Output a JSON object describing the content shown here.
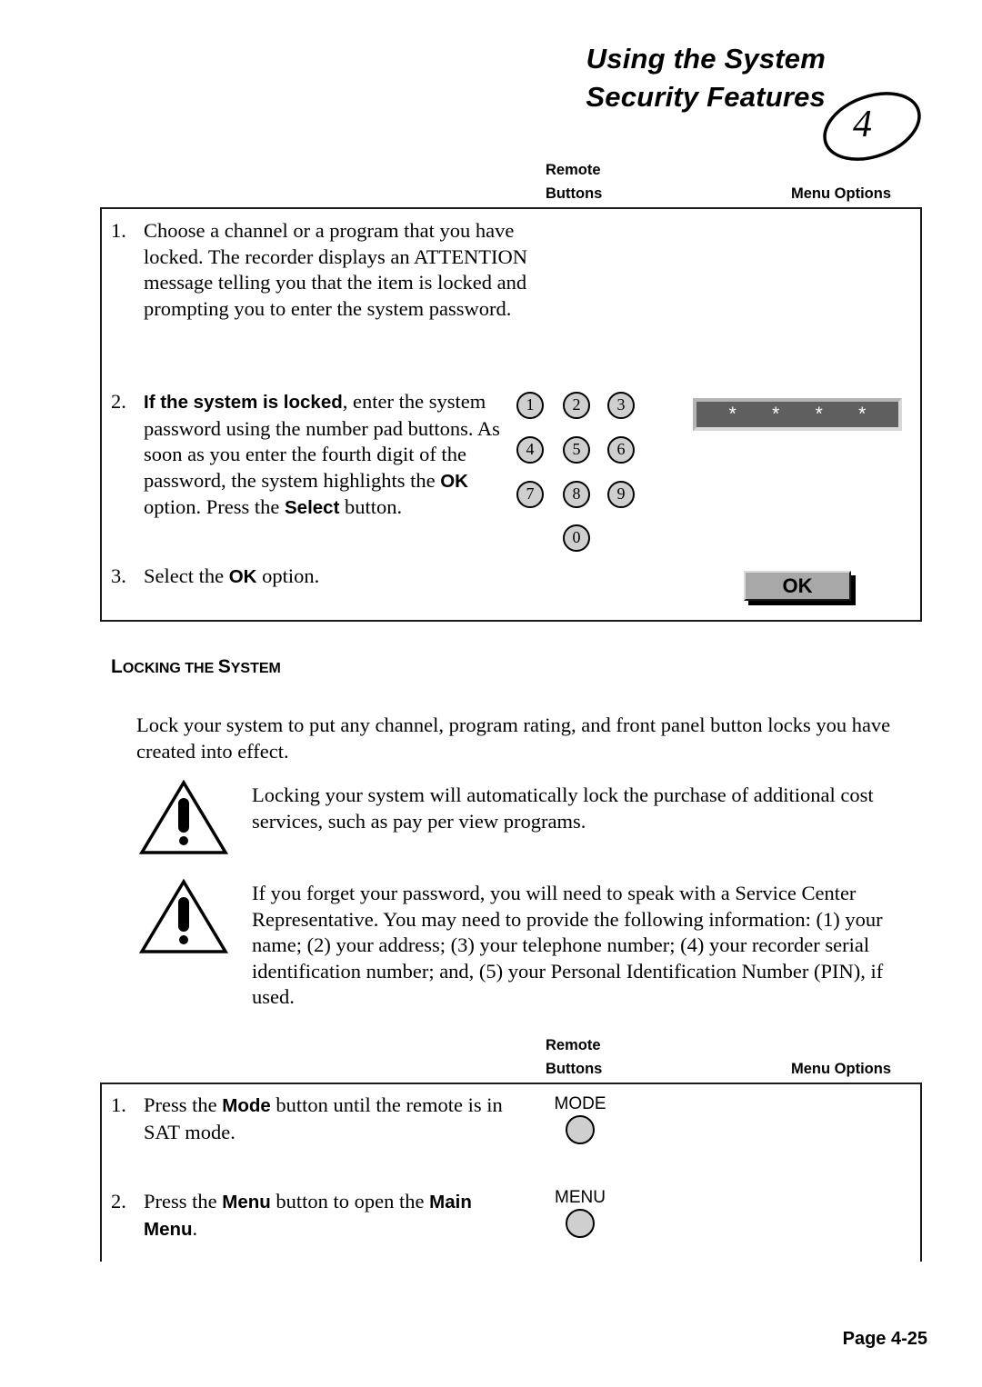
{
  "header": {
    "title_line1": "Using the System",
    "title_line2": "Security Features",
    "chapter_number": "4"
  },
  "table_headers": {
    "remote_buttons_line1": "Remote",
    "remote_buttons_line2": "Buttons",
    "menu_options": "Menu Options"
  },
  "top_table": {
    "steps": [
      {
        "number": "1.",
        "text": "Choose a channel or a program that you have locked.  The recorder displays an ATTENTION message telling you that the item is locked and prompting you to enter the system password."
      },
      {
        "number": "2.",
        "text_parts": [
          {
            "bold": true,
            "text": "If the system is locked"
          },
          {
            "bold": false,
            "text": ", enter the system password using the number pad buttons.  As soon as you enter the fourth digit of the password, the system highlights the "
          },
          {
            "bold": true,
            "text": "OK"
          },
          {
            "bold": false,
            "text": " option.  Press the "
          },
          {
            "bold": true,
            "text": "Select"
          },
          {
            "bold": false,
            "text": " button."
          }
        ]
      },
      {
        "number": "3.",
        "text_parts": [
          {
            "bold": false,
            "text": "Select the "
          },
          {
            "bold": true,
            "text": "OK"
          },
          {
            "bold": false,
            "text": " option."
          }
        ]
      }
    ],
    "keypad": [
      "1",
      "2",
      "3",
      "4",
      "5",
      "6",
      "7",
      "8",
      "9",
      "0"
    ],
    "password_field": {
      "masked_value": [
        "*",
        "*",
        "*",
        "*"
      ],
      "background_color": "#5f5f5f"
    },
    "ok_button": {
      "label": "OK",
      "background_color": "#a8a8a8"
    }
  },
  "section": {
    "heading_initial_1": "L",
    "heading_rest_1": "OCKING",
    "heading_middle": "THE",
    "heading_initial_2": "S",
    "heading_rest_2": "YSTEM",
    "intro_paragraph": "Lock your system to put any channel, program rating, and front panel button locks you have created into effect.",
    "warnings": [
      {
        "icon": "warning-triangle-icon",
        "text": "Locking your system will automatically lock the purchase of additional cost services, such as pay per view programs."
      },
      {
        "icon": "warning-triangle-icon",
        "text": "If you forget your password, you will need to speak with a Service Center Representative.  You may need to provide the following information:  (1) your name;  (2) your address;  (3) your telephone number;  (4) your recorder serial identification number;  and, (5) your Personal Identification Number (PIN), if used."
      }
    ]
  },
  "bottom_table": {
    "steps": [
      {
        "number": "1.",
        "text_parts": [
          {
            "bold": false,
            "text": "Press the "
          },
          {
            "bold": true,
            "text": "Mode"
          },
          {
            "bold": false,
            "text": " button until the remote is in SAT mode."
          }
        ],
        "remote_key": "MODE"
      },
      {
        "number": "2.",
        "text_parts": [
          {
            "bold": false,
            "text": "Press the "
          },
          {
            "bold": true,
            "text": "Menu"
          },
          {
            "bold": false,
            "text": " button to open the "
          },
          {
            "bold": true,
            "text": "Main Menu"
          },
          {
            "bold": false,
            "text": "."
          }
        ],
        "remote_key": "MENU"
      }
    ]
  },
  "footer": {
    "page_label": "Page 4-25"
  }
}
